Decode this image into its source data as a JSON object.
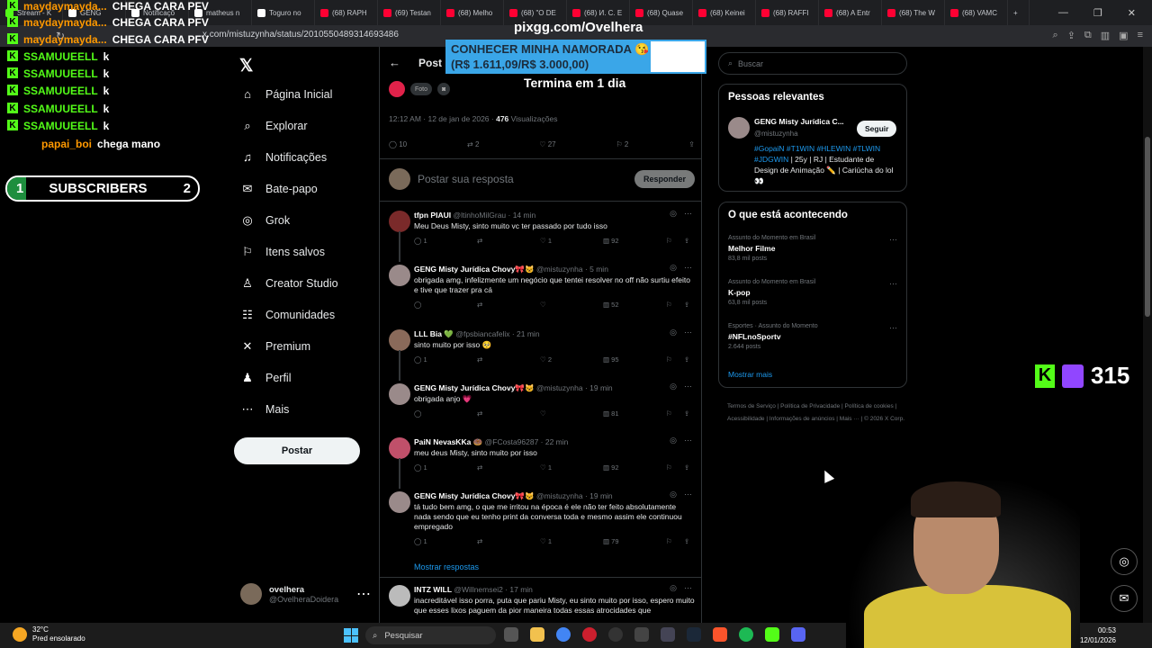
{
  "browser": {
    "tabs": [
      {
        "label": "Stream - K",
        "icon": "kick"
      },
      {
        "label": "GENG",
        "icon": "x"
      },
      {
        "label": "Notificaçõ",
        "icon": "x"
      },
      {
        "label": "matheus n",
        "icon": "x"
      },
      {
        "label": "Toguro no",
        "icon": "x"
      },
      {
        "label": "(68) RAPH",
        "icon": "youtube"
      },
      {
        "label": "(69) Testan",
        "icon": "youtube"
      },
      {
        "label": "(68) Melho",
        "icon": "youtube"
      },
      {
        "label": "(68) \"O DE",
        "icon": "youtube"
      },
      {
        "label": "(68) И. С. Е",
        "icon": "youtube"
      },
      {
        "label": "(68) Quase",
        "icon": "youtube"
      },
      {
        "label": "(68) Keinei",
        "icon": "youtube"
      },
      {
        "label": "(68) RAFFI",
        "icon": "youtube"
      },
      {
        "label": "(68) A Entr",
        "icon": "youtube"
      },
      {
        "label": "(68) The W",
        "icon": "youtube"
      },
      {
        "label": "(68) VAMC",
        "icon": "youtube"
      }
    ],
    "url": "x.com/mistuzynha/status/2010550489314693486"
  },
  "overlay": {
    "chat": [
      {
        "user": "maydaymayda...",
        "msg": "CHEGA CARA PFV",
        "color": "orange"
      },
      {
        "user": "maydaymayda...",
        "msg": "CHEGA CARA PFV",
        "color": "orange"
      },
      {
        "user": "maydaymayda...",
        "msg": "CHEGA CARA PFV",
        "color": "orange"
      },
      {
        "user": "SSAMUUEELL",
        "msg": "k",
        "color": "green"
      },
      {
        "user": "SSAMUUEELL",
        "msg": "k",
        "color": "green"
      },
      {
        "user": "SSAMUUEELL",
        "msg": "k",
        "color": "green"
      },
      {
        "user": "SSAMUUEELL",
        "msg": "k",
        "color": "green"
      },
      {
        "user": "SSAMUUEELL",
        "msg": "k",
        "color": "green"
      },
      {
        "user": "papai_boi",
        "msg": "chega mano",
        "color": "orange"
      }
    ],
    "subs": {
      "left": "1",
      "label": "SUBSCRIBERS",
      "right": "2",
      "progress": 0.1
    },
    "pixgg": "pixgg.com/Ovelhera",
    "donation_line1": "CONHECER MINHA NAMORADA 😘",
    "donation_line2": "(R$ 1.611,09/R$ 3.000,00)",
    "viewer_count": "315"
  },
  "nav": {
    "items": [
      {
        "label": "Página Inicial",
        "icon": "home-icon",
        "glyph": "⌂"
      },
      {
        "label": "Explorar",
        "icon": "search-icon",
        "glyph": "⌕"
      },
      {
        "label": "Notificações",
        "icon": "bell-icon",
        "glyph": "♫"
      },
      {
        "label": "Bate-papo",
        "icon": "mail-icon",
        "glyph": "✉"
      },
      {
        "label": "Grok",
        "icon": "grok-icon",
        "glyph": "◎"
      },
      {
        "label": "Itens salvos",
        "icon": "bookmark-icon",
        "glyph": "⚐"
      },
      {
        "label": "Creator Studio",
        "icon": "creator-icon",
        "glyph": "♙"
      },
      {
        "label": "Comunidades",
        "icon": "communities-icon",
        "glyph": "☷"
      },
      {
        "label": "Premium",
        "icon": "x-icon",
        "glyph": "✕"
      },
      {
        "label": "Perfil",
        "icon": "profile-icon",
        "glyph": "♟"
      },
      {
        "label": "Mais",
        "icon": "more-icon",
        "glyph": "⋯"
      }
    ],
    "post_label": "Postar",
    "account_name": "ovelhera",
    "account_handle": "@OvelheraDoidera"
  },
  "post": {
    "header": "Post",
    "poll_ends": "Termina em 1 dia",
    "photo_chip": "Foto",
    "time": "12:12 AM · 12 de jan de 2026 · ",
    "views": "476",
    "views_label": " Visualizações",
    "stats": {
      "replies": "10",
      "reposts": "2",
      "likes": "27",
      "bookmarks": "2"
    },
    "reply_placeholder": "Postar sua resposta",
    "reply_button": "Responder"
  },
  "replies": [
    {
      "name": "tfpn PIAUI",
      "handle": "@ltinhoMilGrau · 14 min",
      "text": "Meu Deus Misty, sinto muito vc ter passado por tudo isso",
      "r": "1",
      "rt": "",
      "l": "1",
      "v": "92",
      "color": "#7a2a2a"
    },
    {
      "name": "GENG Misty Jurídica Chovy🎀😺",
      "handle": "@mistuzynha · 5 min",
      "text": "obrigada amg, infelizmente um negócio que tentei resolver no off não surtiu efeito e tive que trazer pra cá",
      "r": "",
      "rt": "",
      "l": "",
      "v": "52",
      "color": "#9a8a8a"
    },
    {
      "name": "LLL Bia 💚",
      "handle": "@fpsbiancafelix · 21 min",
      "text": "sinto muito por isso 🥺",
      "r": "1",
      "rt": "",
      "l": "2",
      "v": "95",
      "color": "#8a6a5a"
    },
    {
      "name": "GENG Misty Jurídica Chovy🎀😺",
      "handle": "@mistuzynha · 19 min",
      "text": "obrigada anjo 💗",
      "r": "",
      "rt": "",
      "l": "",
      "v": "81",
      "color": "#9a8a8a"
    },
    {
      "name": "PaiN NevasKKa 🍩",
      "handle": "@FCosta96287 · 22 min",
      "text": "meu deus Misty, sinto muito por isso",
      "r": "1",
      "rt": "",
      "l": "1",
      "v": "92",
      "color": "#c0506a"
    },
    {
      "name": "GENG Misty Jurídica Chovy🎀😺",
      "handle": "@mistuzynha · 19 min",
      "text": "tá tudo bem amg, o que me irritou na época é ele não ter feito absolutamente nada sendo que eu tenho print da conversa toda e mesmo assim ele continuou empregado",
      "r": "1",
      "rt": "",
      "l": "1",
      "v": "79",
      "color": "#9a8a8a"
    },
    {
      "name": "INTZ WILL",
      "handle": "@Willnemsei2 · 17 min",
      "text": "inacreditável isso porra, puta que pariu Misty, eu sinto muito por isso, espero muito que esses lixos paguem da pior maneira todas essas atrocidades que",
      "r": "",
      "rt": "",
      "l": "",
      "v": "",
      "color": "#bbbbbb"
    }
  ],
  "show_replies": "Mostrar respostas",
  "right": {
    "search_placeholder": "Buscar",
    "relevant_title": "Pessoas relevantes",
    "relevant_name": "GENG Misty Jurídica C...",
    "relevant_handle": "@mistuzynha",
    "follow": "Seguir",
    "bio_tags": "#GopaiN #T1WIN #HLEWIN #TLWIN #JDGWIN",
    "bio_text": " | 25y | RJ | Estudante de Design de Animação ✏️ | Cariúcha do lol 👀",
    "trends_title": "O que está acontecendo",
    "trends": [
      {
        "ctx": "Assunto do Momento em Brasil",
        "name": "Melhor Filme",
        "count": "83,8 mil posts"
      },
      {
        "ctx": "Assunto do Momento em Brasil",
        "name": "K-pop",
        "count": "63,8 mil posts"
      },
      {
        "ctx": "Esportes · Assunto do Momento",
        "name": "#NFLnoSportv",
        "count": "2.644 posts"
      }
    ],
    "show_more": "Mostrar mais",
    "footer": "Termos de Serviço | Política de Privacidade | Política de cookies | Acessibilidade | Informações de anúncios | Mais ··· | © 2026 X Corp."
  },
  "taskbar": {
    "temp": "32°C",
    "weather": "Pred ensolarado",
    "search": "Pesquisar",
    "time": "00:53",
    "date": "12/01/2026"
  }
}
